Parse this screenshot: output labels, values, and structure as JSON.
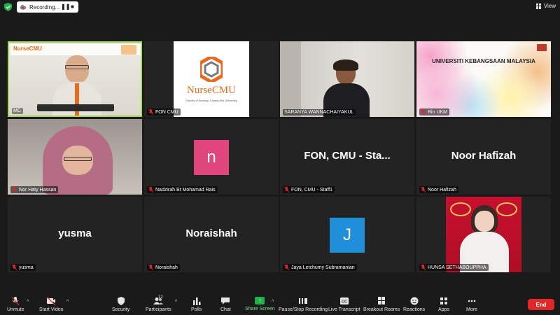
{
  "top": {
    "recording_label": "Recording...",
    "view_label": "View"
  },
  "tiles": [
    {
      "name": "MC",
      "type": "video"
    },
    {
      "name": "FON CMU",
      "type": "logo",
      "logo_text": "NurseCMU",
      "logo_sub": "Faculty of Nursing, Chiang Mai University"
    },
    {
      "name": "SARANYA WANNACHAIYAKUL",
      "type": "video"
    },
    {
      "name": "Rin UKM",
      "type": "banner",
      "banner_text": "UNIVERSITI KEBANGSAAN MALAYSIA"
    },
    {
      "name": "Nor Haty Hassan",
      "type": "video"
    },
    {
      "name": "Nadzirah Bt Mohamad Rais",
      "type": "avatar",
      "initial": "n",
      "color": "#e0457b"
    },
    {
      "name": "FON, CMU - Staff1",
      "type": "text",
      "display": "FON, CMU - Sta..."
    },
    {
      "name": "Noor Hafizah",
      "type": "text",
      "display": "Noor Hafizah"
    },
    {
      "name": "yusma",
      "type": "text",
      "display": "yusma"
    },
    {
      "name": "Noraishah",
      "type": "text",
      "display": "Noraishah"
    },
    {
      "name": "Jaya Letchumy Subramanian",
      "type": "avatar",
      "initial": "J",
      "color": "#1e8fd8"
    },
    {
      "name": "HUNSA SETHABOUPPHA",
      "type": "video"
    }
  ],
  "mc_logo_text": "NurseCMU",
  "toolbar": {
    "unmute": "Unmute",
    "start_video": "Start Video",
    "security": "Security",
    "participants": "Participants",
    "participants_count": "12",
    "polls": "Polls",
    "chat": "Chat",
    "share_screen": "Share Screen",
    "pause_recording": "Pause/Stop Recording",
    "live_transcript": "Live Transcript",
    "breakout_rooms": "Breakout Rooms",
    "reactions": "Reactions",
    "apps": "Apps",
    "more": "More",
    "end": "End"
  },
  "colors": {
    "active_speaker_border": "#a6d94f",
    "share_green": "#22b04b",
    "end_red": "#e02828",
    "background": "#1a1a1a",
    "tile": "#232323"
  }
}
